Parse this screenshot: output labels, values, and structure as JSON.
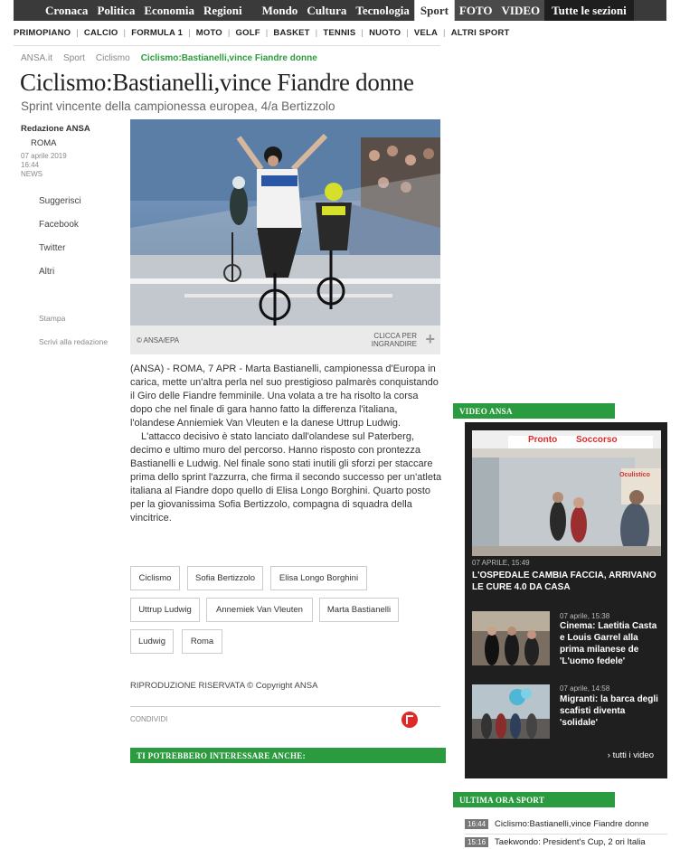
{
  "topnav": {
    "items": [
      "Cronaca",
      "Politica",
      "Economia",
      "Regioni",
      "Mondo",
      "Cultura",
      "Tecnologia",
      "Sport",
      "FOTO",
      "VIDEO",
      "Tutte le sezioni"
    ]
  },
  "subnav": {
    "items": [
      "PRIMOPIANO",
      "CALCIO",
      "FORMULA 1",
      "MOTO",
      "GOLF",
      "BASKET",
      "TENNIS",
      "NUOTO",
      "VELA",
      "ALTRI SPORT"
    ]
  },
  "breadcrumb": [
    "ANSA.it",
    "Sport",
    "Ciclismo",
    "Ciclismo:Bastianelli,vince Fiandre donne"
  ],
  "article": {
    "title": "Ciclismo:Bastianelli,vince Fiandre donne",
    "subtitle": "Sprint vincente della campionessa europea, 4/a Bertizzolo",
    "author": "Redazione ANSA",
    "city": "ROMA",
    "date": "07 aprile 2019",
    "time": "16:44",
    "type": "NEWS",
    "image_credit": "© ANSA/EPA",
    "zoom_label_1": "CLICCA PER",
    "zoom_label_2": "INGRANDIRE",
    "paragraph1": "(ANSA) - ROMA, 7 APR - Marta Bastianelli, campionessa d'Europa in carica, mette un'altra perla nel suo prestigioso palmarès conquistando il Giro delle Fiandre femminile. Una volata a tre ha risolto la corsa dopo che nel finale di gara hanno fatto la differenza l'italiana, l'olandese Anniemiek Van Vleuten e la danese Uttrup Ludwig.",
    "paragraph2": "L'attacco decisivo è stato lanciato dall'olandese sul Paterberg, decimo e ultimo muro del percorso. Hanno risposto con prontezza Bastianelli e Ludwig. Nel finale sono stati inutili gli sforzi per staccare prima dello sprint l'azzurra, che firma il secondo successo per un'atleta italiana al Fiandre dopo quello di Elisa Longo Borghini. Quarto posto per la giovanissima Sofia Bertizzolo, compagna di squadra della vincitrice.",
    "tags": [
      "Ciclismo",
      "Sofia Bertizzolo",
      "Elisa Longo Borghini",
      "Uttrup Ludwig",
      "Annemiek Van Vleuten",
      "Marta Bastianelli",
      "Ludwig",
      "Roma"
    ],
    "copyright": "RIPRODUZIONE RISERVATA © Copyright ANSA",
    "share": "CONDIVIDI",
    "related_header": "TI POTREBBERO INTERESSARE ANCHE:"
  },
  "social": [
    "Suggerisci",
    "Facebook",
    "Twitter",
    "Altri"
  ],
  "tools": [
    "Stampa",
    "Scrivi alla redazione"
  ],
  "video_ansa": {
    "header": "VIDEO ANSA",
    "main": {
      "date": "07 APRILE, 15:49",
      "title": "L'OSPEDALE CAMBIA FACCIA, ARRIVANO LE CURE 4.0 DA CASA",
      "sign1": "Pronto",
      "sign2": "Soccorso",
      "sign3": "Oculistico"
    },
    "items": [
      {
        "date": "07 aprile, 15:38",
        "title": "Cinema: Laetitia Casta e Louis Garrel alla prima milanese de 'L'uomo fedele'"
      },
      {
        "date": "07 aprile, 14:58",
        "title": "Migranti: la barca degli scafisti diventa 'solidale'"
      }
    ],
    "all_link": "› tutti i video"
  },
  "ultima_ora": {
    "header": "ULTIMA ORA SPORT",
    "items": [
      {
        "time": "16:44",
        "title": "Ciclismo:Bastianelli,vince Fiandre donne"
      },
      {
        "time": "15:16",
        "title": "Taekwondo: President's Cup, 2 ori Italia"
      }
    ]
  },
  "colors": {
    "accent_green": "#2a9b3e",
    "nav_dark": "#3a3a3a",
    "video_box": "#1f1f1f"
  }
}
